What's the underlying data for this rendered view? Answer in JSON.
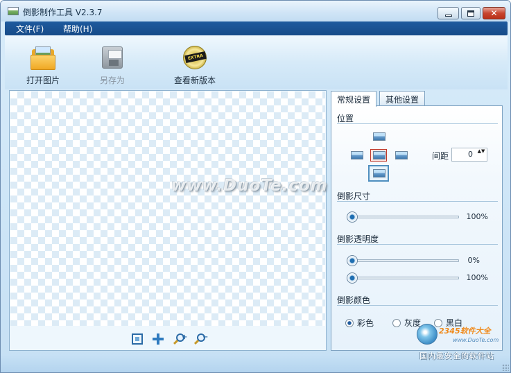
{
  "window": {
    "title": "倒影制作工具 V2.3.7",
    "controls": {
      "minimize": "—",
      "maximize": "□",
      "close": "✕"
    }
  },
  "menu": {
    "items": [
      {
        "label": "文件(F)"
      },
      {
        "label": "帮助(H)"
      }
    ]
  },
  "toolbar": {
    "open_label": "打开图片",
    "save_as_label": "另存为",
    "new_version_label": "查看新版本",
    "cd_tag": "EXTRA"
  },
  "canvas": {
    "tools": [
      "fit-to-window",
      "pan",
      "zoom-in",
      "zoom-out"
    ],
    "zoom_in_sign": "+",
    "zoom_out_sign": "−"
  },
  "settings": {
    "tabs": [
      {
        "label": "常规设置",
        "active": true
      },
      {
        "label": "其他设置",
        "active": false
      }
    ],
    "position": {
      "title": "位置",
      "selected": "center",
      "spacing_label": "间距",
      "spacing_value": "0",
      "spin_arrows": "▲▼"
    },
    "size": {
      "title": "倒影尺寸",
      "value_label": "100%",
      "level": 0.0
    },
    "opacity": {
      "title": "倒影透明度",
      "start_label": "0%",
      "start_level": 0.0,
      "end_label": "100%",
      "end_level": 0.0
    },
    "color": {
      "title": "倒影颜色",
      "options": [
        {
          "label": "彩色",
          "checked": true
        },
        {
          "label": "灰度",
          "checked": false
        },
        {
          "label": "黑白",
          "checked": false
        }
      ]
    }
  },
  "overlay": {
    "watermark": "www.DuoTe.com",
    "badge_brand": "2345软件大全",
    "badge_url": "www.DuoTe.com",
    "badge_slogan": "国内最安全的软件站"
  },
  "colors": {
    "menubar": "#1e5a9e",
    "close_button": "#c8452f",
    "selected_position": "#c0392b"
  }
}
